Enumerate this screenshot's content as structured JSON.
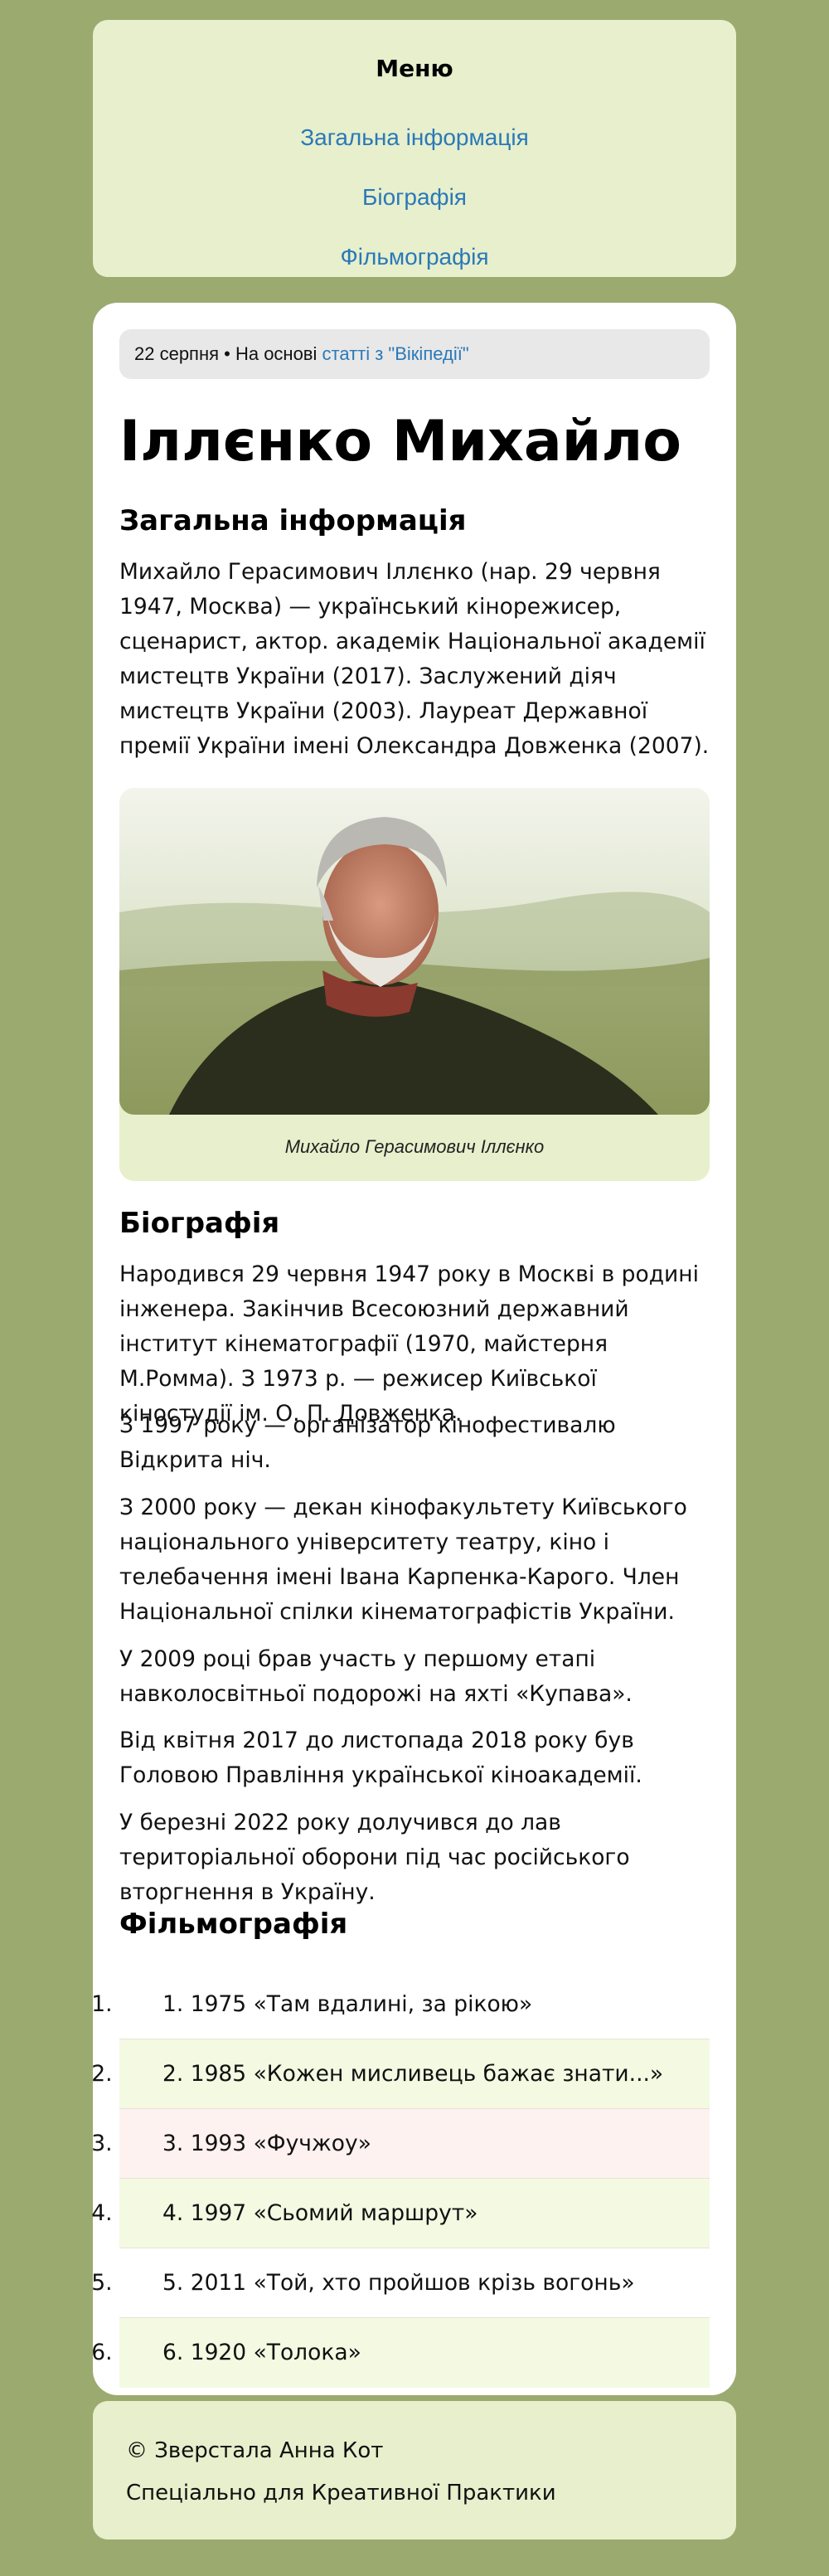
{
  "menu": {
    "title": "Меню",
    "items": [
      "Загальна інформація",
      "Біографія",
      "Фільмографія"
    ]
  },
  "meta": {
    "date_prefix": "22 серпня • На основі ",
    "link": "статті з \"Вікіпедії\""
  },
  "title": "Іллєнко Михайло",
  "general": {
    "heading": "Загальна інформація",
    "text": "Михайло Герасимович Іллєнко (нар. 29 червня 1947, Москва) — український кінорежисер, сценарист, актор. академік Національної академії мистецтв України (2017). Заслужений діяч мистецтв України (2003). Лауреат Державної премії України імені Олександра Довженка (2007)."
  },
  "figure": {
    "caption": "Михайло Герасимович Іллєнко"
  },
  "biography": {
    "heading": "Біографія",
    "paragraphs": [
      "Народився 29 червня 1947 року в Москві в родині інженера. Закінчив Всесоюзний державний інститут кінематографії (1970, майстерня М.Ромма). З 1973 р. — режисер Київської кіностудії ім. О. П. Довженка.",
      "З 1997 року — організатор кінофестивалю Відкрита ніч.",
      "З 2000 року — декан кінофакультету Київського національного університету театру, кіно і телебачення імені Івана Карпенка-Карого. Член Національної спілки кінематографістів України.",
      "У 2009 році брав участь у першому етапі навколосвітньої подорожі на яхті «Купава».",
      "Від квітня 2017 до листопада 2018 року був Головою Правління української кіноакадемії.",
      "У березні 2022 року долучився до лав територіальної оборони під час російського вторгнення в Україну."
    ]
  },
  "filmography": {
    "heading": "Фільмографія",
    "items": [
      "1. 1975 «Там вдалині, за рікою»",
      "2. 1985 «Кожен мисливець бажає знати...»",
      "3. 1993 «Фучжоу»",
      "4. 1997 «Сьомий маршрут»",
      "5. 2011 «Той, хто пройшов крізь вогонь»",
      "6. 1920 «Толока»"
    ]
  },
  "footer": {
    "line1": "© Зверстала Анна Кот",
    "line2": "Спеціально для Креативної Практики"
  },
  "colors": {
    "background": "#9baa6e",
    "panel": "#e7efcc",
    "link": "#2a79b8",
    "row_alt": "#f4f9e2",
    "row_pink": "#fdf2ef"
  }
}
